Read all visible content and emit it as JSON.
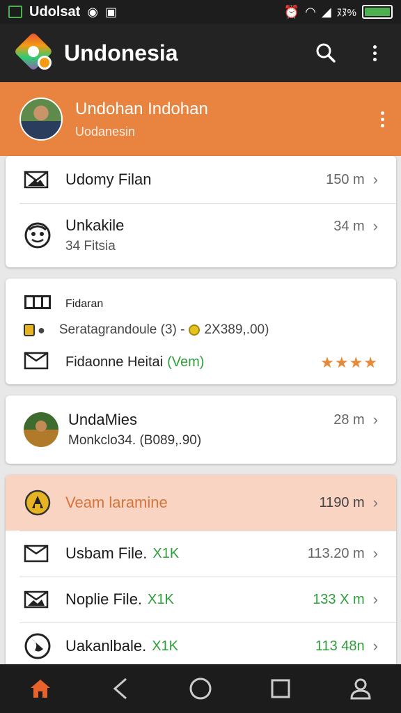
{
  "status_bar": {
    "app_name": "Udolsat",
    "signal_text": "ﾇﾇ%",
    "battery_text": ""
  },
  "app_bar": {
    "title": "Undonesia"
  },
  "profile": {
    "name": "Undohan Indohan",
    "subtitle": "Uodanesin"
  },
  "card1": {
    "rows": [
      {
        "title": "Udomy Filan",
        "meta": "150 m"
      },
      {
        "title": "Unkakile",
        "subtitle": "34 Fitsia",
        "meta": "34 m"
      }
    ]
  },
  "card2": {
    "title": "Fidaran",
    "detail_left": "Seratagrandoule (3) -",
    "detail_right": "2X389,.00)",
    "row2_title": "Fidaonne Heitai",
    "row2_tag": "(Vem)",
    "rating_stars": "★★★★"
  },
  "card3": {
    "title": "UndaMies",
    "subtitle": "Monkclo34. (B089,.90)",
    "meta": "28 m"
  },
  "card4": {
    "header": {
      "title": "Veam laramine",
      "meta": "1190 m"
    },
    "rows": [
      {
        "title": "Usbam File.",
        "tag": "X1K",
        "meta": "113.20 m"
      },
      {
        "title": "Noplie File.",
        "tag": "X1K",
        "meta": "133 X m"
      },
      {
        "title": "Uakanlbale.",
        "tag": "X1K",
        "meta": "113 48n"
      }
    ]
  },
  "colors": {
    "accent": "#e8843f",
    "highlight_bg": "#f9d4c3",
    "appbar": "#232323",
    "green": "#2e9e3a"
  }
}
